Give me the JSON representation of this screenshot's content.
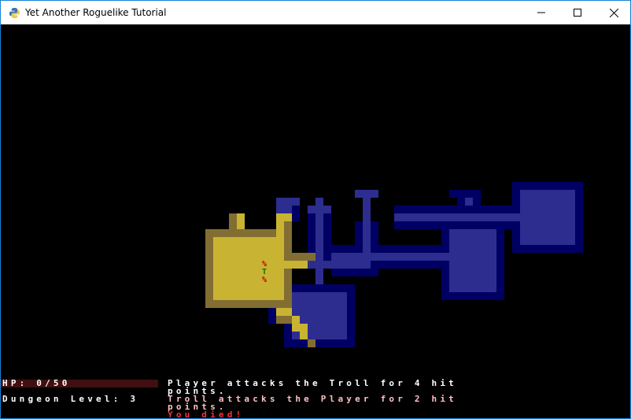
{
  "window": {
    "title": "Yet Another Roguelike Tutorial"
  },
  "icons": {
    "app": "python-icon",
    "minimize": "minimize-icon",
    "maximize": "maximize-icon",
    "close": "close-icon"
  },
  "colors": {
    "floor_dark": "#2d2d8f",
    "wall_dark": "#000064",
    "floor_light": "#c8b432",
    "wall_light": "#826e32",
    "corpse": "#bf0000",
    "troll": "#007f00",
    "hp_bar_bg": "#401010",
    "hp_bar_fill": "#007f00",
    "log_white": "#ffffff",
    "log_died": "#ff3030",
    "log_enemy": "#ffc0c0"
  },
  "status": {
    "hp_text": "HP: 0/50",
    "hp_current": 0,
    "hp_max": 50,
    "dungeon_level": "Dungeon Level: 3"
  },
  "entities": [
    {
      "char": "%",
      "name": "corpse",
      "color": "#bf0000"
    },
    {
      "char": "T",
      "name": "troll",
      "color": "#007f00"
    },
    {
      "char": "%",
      "name": "corpse",
      "color": "#bf0000"
    }
  ],
  "messages": [
    {
      "text": "Player attacks the Troll for 4 hit",
      "color": "#ffffff"
    },
    {
      "text": "points.",
      "color": "#ffffff"
    },
    {
      "text": "Troll attacks the Player for 2 hit",
      "color": "#ffc0c0"
    },
    {
      "text": "points.",
      "color": "#ffc0c0"
    },
    {
      "text": "You died!",
      "color": "#ff3030"
    }
  ]
}
